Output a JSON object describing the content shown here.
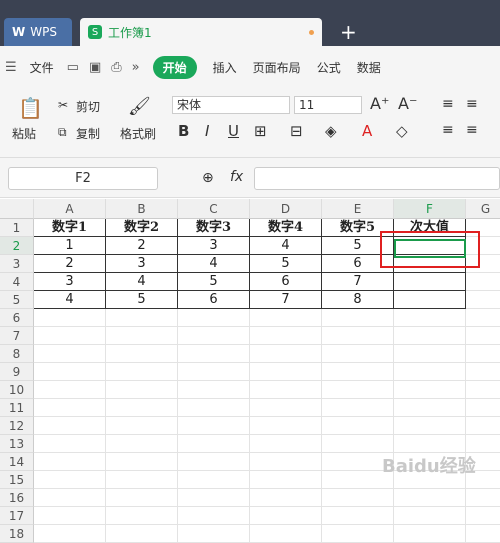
{
  "tabs": {
    "wps": "WPS",
    "doc": "工作簿1"
  },
  "menu": {
    "file": "文件",
    "items": [
      "开始",
      "插入",
      "页面布局",
      "公式",
      "数据"
    ]
  },
  "ribbon": {
    "paste": "粘贴",
    "cut": "剪切",
    "copy": "复制",
    "painter": "格式刷",
    "font": "宋体",
    "size": "11"
  },
  "formula": {
    "name": "F2",
    "fx": "fx"
  },
  "columns": [
    "A",
    "B",
    "C",
    "D",
    "E",
    "F",
    "G"
  ],
  "rows": [
    "1",
    "2",
    "3",
    "4",
    "5",
    "6",
    "7",
    "8",
    "9",
    "10",
    "11",
    "12",
    "13",
    "14",
    "15",
    "16",
    "17",
    "18"
  ],
  "table": {
    "headers": [
      "数字1",
      "数字2",
      "数字3",
      "数字4",
      "数字5",
      "次大值"
    ],
    "data": [
      [
        "1",
        "2",
        "3",
        "4",
        "5",
        ""
      ],
      [
        "2",
        "3",
        "4",
        "5",
        "6",
        ""
      ],
      [
        "3",
        "4",
        "5",
        "6",
        "7",
        ""
      ],
      [
        "4",
        "5",
        "6",
        "7",
        "8",
        ""
      ]
    ]
  },
  "watermark": "Baidu经验"
}
